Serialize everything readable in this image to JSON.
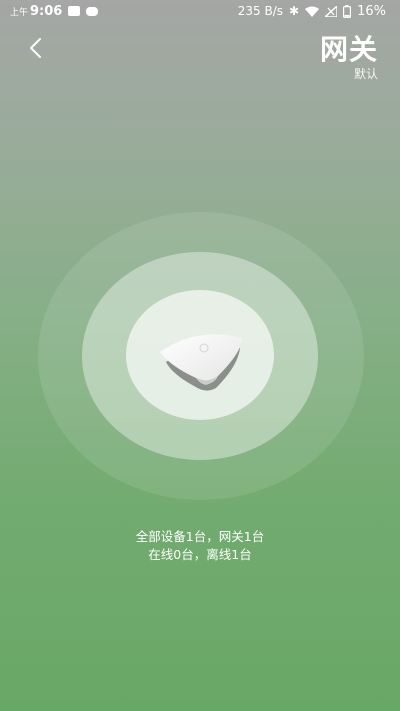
{
  "status_bar": {
    "period": "上午",
    "time": "9:06",
    "network_speed": "235 B/s",
    "battery": "16%",
    "icons": [
      "image-icon",
      "message-icon",
      "bluetooth-icon",
      "wifi-icon",
      "signal-icon",
      "battery-icon"
    ]
  },
  "header": {
    "title": "网关",
    "subtitle": "默认",
    "back_icon": "chevron-left-icon"
  },
  "summary": {
    "line1": "全部设备1台，网关1台",
    "line2": "在线0台，离线1台"
  },
  "colors": {
    "background_top": "#a5a6a5",
    "background_bottom": "#68a866",
    "text": "#ffffff"
  }
}
